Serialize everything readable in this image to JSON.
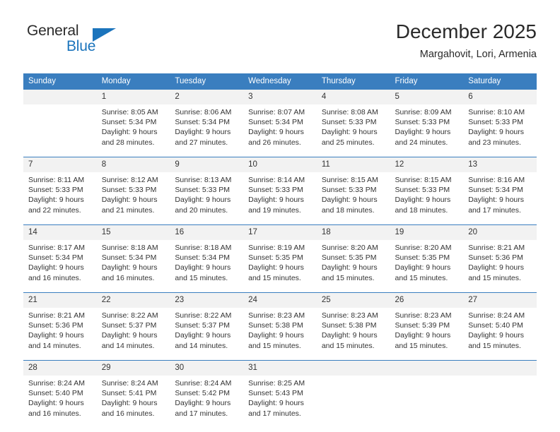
{
  "brand": {
    "name_part1": "General",
    "name_part2": "Blue"
  },
  "header": {
    "month_title": "December 2025",
    "location": "Margahovit, Lori, Armenia"
  },
  "colors": {
    "header_blue": "#3a7ebf",
    "brand_blue": "#1b74bc",
    "daynum_band": "#f2f2f2",
    "text": "#333333"
  },
  "calendar": {
    "weekday_headers": [
      "Sunday",
      "Monday",
      "Tuesday",
      "Wednesday",
      "Thursday",
      "Friday",
      "Saturday"
    ],
    "weeks": [
      [
        {
          "day": "",
          "lines": [
            "",
            "",
            "",
            ""
          ]
        },
        {
          "day": "1",
          "lines": [
            "Sunrise: 8:05 AM",
            "Sunset: 5:34 PM",
            "Daylight: 9 hours",
            "and 28 minutes."
          ]
        },
        {
          "day": "2",
          "lines": [
            "Sunrise: 8:06 AM",
            "Sunset: 5:34 PM",
            "Daylight: 9 hours",
            "and 27 minutes."
          ]
        },
        {
          "day": "3",
          "lines": [
            "Sunrise: 8:07 AM",
            "Sunset: 5:34 PM",
            "Daylight: 9 hours",
            "and 26 minutes."
          ]
        },
        {
          "day": "4",
          "lines": [
            "Sunrise: 8:08 AM",
            "Sunset: 5:33 PM",
            "Daylight: 9 hours",
            "and 25 minutes."
          ]
        },
        {
          "day": "5",
          "lines": [
            "Sunrise: 8:09 AM",
            "Sunset: 5:33 PM",
            "Daylight: 9 hours",
            "and 24 minutes."
          ]
        },
        {
          "day": "6",
          "lines": [
            "Sunrise: 8:10 AM",
            "Sunset: 5:33 PM",
            "Daylight: 9 hours",
            "and 23 minutes."
          ]
        }
      ],
      [
        {
          "day": "7",
          "lines": [
            "Sunrise: 8:11 AM",
            "Sunset: 5:33 PM",
            "Daylight: 9 hours",
            "and 22 minutes."
          ]
        },
        {
          "day": "8",
          "lines": [
            "Sunrise: 8:12 AM",
            "Sunset: 5:33 PM",
            "Daylight: 9 hours",
            "and 21 minutes."
          ]
        },
        {
          "day": "9",
          "lines": [
            "Sunrise: 8:13 AM",
            "Sunset: 5:33 PM",
            "Daylight: 9 hours",
            "and 20 minutes."
          ]
        },
        {
          "day": "10",
          "lines": [
            "Sunrise: 8:14 AM",
            "Sunset: 5:33 PM",
            "Daylight: 9 hours",
            "and 19 minutes."
          ]
        },
        {
          "day": "11",
          "lines": [
            "Sunrise: 8:15 AM",
            "Sunset: 5:33 PM",
            "Daylight: 9 hours",
            "and 18 minutes."
          ]
        },
        {
          "day": "12",
          "lines": [
            "Sunrise: 8:15 AM",
            "Sunset: 5:33 PM",
            "Daylight: 9 hours",
            "and 18 minutes."
          ]
        },
        {
          "day": "13",
          "lines": [
            "Sunrise: 8:16 AM",
            "Sunset: 5:34 PM",
            "Daylight: 9 hours",
            "and 17 minutes."
          ]
        }
      ],
      [
        {
          "day": "14",
          "lines": [
            "Sunrise: 8:17 AM",
            "Sunset: 5:34 PM",
            "Daylight: 9 hours",
            "and 16 minutes."
          ]
        },
        {
          "day": "15",
          "lines": [
            "Sunrise: 8:18 AM",
            "Sunset: 5:34 PM",
            "Daylight: 9 hours",
            "and 16 minutes."
          ]
        },
        {
          "day": "16",
          "lines": [
            "Sunrise: 8:18 AM",
            "Sunset: 5:34 PM",
            "Daylight: 9 hours",
            "and 15 minutes."
          ]
        },
        {
          "day": "17",
          "lines": [
            "Sunrise: 8:19 AM",
            "Sunset: 5:35 PM",
            "Daylight: 9 hours",
            "and 15 minutes."
          ]
        },
        {
          "day": "18",
          "lines": [
            "Sunrise: 8:20 AM",
            "Sunset: 5:35 PM",
            "Daylight: 9 hours",
            "and 15 minutes."
          ]
        },
        {
          "day": "19",
          "lines": [
            "Sunrise: 8:20 AM",
            "Sunset: 5:35 PM",
            "Daylight: 9 hours",
            "and 15 minutes."
          ]
        },
        {
          "day": "20",
          "lines": [
            "Sunrise: 8:21 AM",
            "Sunset: 5:36 PM",
            "Daylight: 9 hours",
            "and 15 minutes."
          ]
        }
      ],
      [
        {
          "day": "21",
          "lines": [
            "Sunrise: 8:21 AM",
            "Sunset: 5:36 PM",
            "Daylight: 9 hours",
            "and 14 minutes."
          ]
        },
        {
          "day": "22",
          "lines": [
            "Sunrise: 8:22 AM",
            "Sunset: 5:37 PM",
            "Daylight: 9 hours",
            "and 14 minutes."
          ]
        },
        {
          "day": "23",
          "lines": [
            "Sunrise: 8:22 AM",
            "Sunset: 5:37 PM",
            "Daylight: 9 hours",
            "and 14 minutes."
          ]
        },
        {
          "day": "24",
          "lines": [
            "Sunrise: 8:23 AM",
            "Sunset: 5:38 PM",
            "Daylight: 9 hours",
            "and 15 minutes."
          ]
        },
        {
          "day": "25",
          "lines": [
            "Sunrise: 8:23 AM",
            "Sunset: 5:38 PM",
            "Daylight: 9 hours",
            "and 15 minutes."
          ]
        },
        {
          "day": "26",
          "lines": [
            "Sunrise: 8:23 AM",
            "Sunset: 5:39 PM",
            "Daylight: 9 hours",
            "and 15 minutes."
          ]
        },
        {
          "day": "27",
          "lines": [
            "Sunrise: 8:24 AM",
            "Sunset: 5:40 PM",
            "Daylight: 9 hours",
            "and 15 minutes."
          ]
        }
      ],
      [
        {
          "day": "28",
          "lines": [
            "Sunrise: 8:24 AM",
            "Sunset: 5:40 PM",
            "Daylight: 9 hours",
            "and 16 minutes."
          ]
        },
        {
          "day": "29",
          "lines": [
            "Sunrise: 8:24 AM",
            "Sunset: 5:41 PM",
            "Daylight: 9 hours",
            "and 16 minutes."
          ]
        },
        {
          "day": "30",
          "lines": [
            "Sunrise: 8:24 AM",
            "Sunset: 5:42 PM",
            "Daylight: 9 hours",
            "and 17 minutes."
          ]
        },
        {
          "day": "31",
          "lines": [
            "Sunrise: 8:25 AM",
            "Sunset: 5:43 PM",
            "Daylight: 9 hours",
            "and 17 minutes."
          ]
        },
        {
          "day": "",
          "lines": [
            "",
            "",
            "",
            ""
          ]
        },
        {
          "day": "",
          "lines": [
            "",
            "",
            "",
            ""
          ]
        },
        {
          "day": "",
          "lines": [
            "",
            "",
            "",
            ""
          ]
        }
      ]
    ]
  }
}
